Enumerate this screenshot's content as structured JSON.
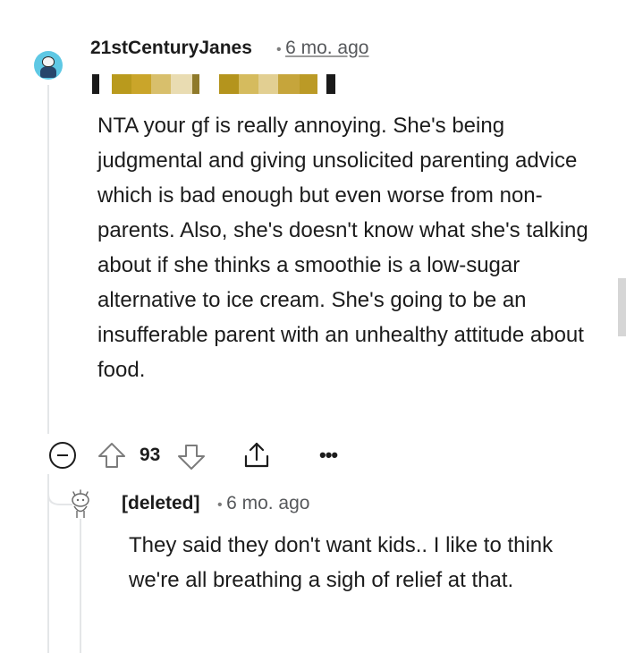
{
  "comment": {
    "username": "21stCenturyJanes",
    "separator": "•",
    "timestamp": "6 mo. ago",
    "flair_censored": true,
    "body": "NTA your gf is really annoying. She's being judgmental and giving unsolicited parenting advice which is bad enough but even worse from non-parents. Also, she's doesn't know what she's talking about if she thinks a smoothie is a low-sugar alternative to ice cream. She's going to be an insufferable parent with an unhealthy attitude about food.",
    "avatar_color": "#5ec8e4"
  },
  "actions": {
    "collapse_icon": "collapse-minus-icon",
    "upvote_icon": "upvote-arrow-icon",
    "vote_count": "93",
    "downvote_icon": "downvote-arrow-icon",
    "share_icon": "share-icon",
    "more_label": "•••"
  },
  "reply": {
    "username": "[deleted]",
    "separator": "•",
    "timestamp": "6 mo. ago",
    "avatar_icon": "deleted-user-avatar-icon",
    "body": "They said they don't want kids.. I like to think we're all breathing a sigh of relief at that."
  }
}
